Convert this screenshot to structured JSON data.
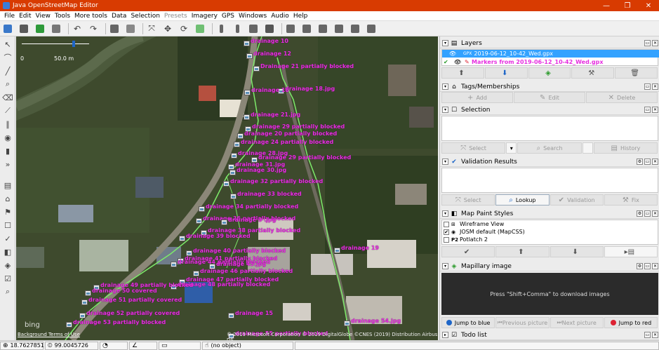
{
  "window": {
    "title": "Java OpenStreetMap Editor",
    "min": "—",
    "max": "❐",
    "close": "✕"
  },
  "menu": [
    {
      "label": "File",
      "enabled": true
    },
    {
      "label": "Edit",
      "enabled": true
    },
    {
      "label": "View",
      "enabled": true
    },
    {
      "label": "Tools",
      "enabled": true
    },
    {
      "label": "More tools",
      "enabled": true
    },
    {
      "label": "Data",
      "enabled": true
    },
    {
      "label": "Selection",
      "enabled": true
    },
    {
      "label": "Presets",
      "enabled": false
    },
    {
      "label": "Imagery",
      "enabled": true
    },
    {
      "label": "GPS",
      "enabled": true
    },
    {
      "label": "Windows",
      "enabled": true
    },
    {
      "label": "Audio",
      "enabled": true
    },
    {
      "label": "Help",
      "enabled": true
    }
  ],
  "map": {
    "scale_zero": "0",
    "scale_max": "50.0 m",
    "bing": "bing",
    "terms": "Background Terms of Use",
    "copyright": "© 2019 Microsoft Corporation © 2019 DigitalGlobe ©CNES (2019) Distribution Airbus DS",
    "labels": [
      "drainage 10",
      "drainage 12",
      "Drainage 21 partially blocked",
      "drainage 18.jpg",
      "drainage 18",
      "drainage 21.jpg",
      "drainage 29 partially blocked",
      "drainage 20 partially blocked",
      "drainage 24 partially blocked",
      "drainage 28.jpg",
      "drainage 29 partially blocked",
      "drainage 31.jpg",
      "drainage 30.jpg",
      "drainage 32 partially blocked",
      "drainage 33 blocked",
      "drainage 34 partially blocked",
      "drainage 36 partially blocked",
      "drainage 3 .jpg",
      "drainage 38 partially blocked",
      "drainage 39 blocked",
      "drainage 40 partially blocked",
      "drainage 41 partially blocked",
      "drainage 44 partially blocked",
      "drainage 45.jpg",
      "drainage 46 partially blocked",
      "drainage 47 partially blocked",
      "drainage 48 partially blocked",
      "drainage 49 partially blocked",
      "drainage 50 covered",
      "drainage 51 partially covered",
      "drainage 52 partially covered",
      "drainage 53 partially blocked",
      "drainage 15",
      "drainage 54.jpg",
      "drainage 55 partially blocked",
      "drainage 19"
    ]
  },
  "panels": {
    "layers": {
      "title": "Layers",
      "items": [
        {
          "name": "2019-06-12_10-42_Wed.gpx",
          "selected": true,
          "tag": "GPX"
        },
        {
          "name": "Markers from 2019-06-12_10-42_Wed.gpx",
          "selected": false,
          "tag": "MK"
        }
      ]
    },
    "tags": {
      "title": "Tags/Memberships",
      "add": "Add",
      "edit": "Edit",
      "delete": "Delete"
    },
    "selection": {
      "title": "Selection",
      "select": "Select",
      "search": "Search",
      "history": "History"
    },
    "validation": {
      "title": "Validation Results",
      "select": "Select",
      "lookup": "Lookup",
      "validation": "Validation",
      "fix": "Fix"
    },
    "paint": {
      "title": "Map Paint Styles",
      "styles": [
        {
          "label": "Wireframe View",
          "checked": false,
          "icon": "W"
        },
        {
          "label": "JOSM default (MapCSS)",
          "checked": true,
          "icon": "J"
        },
        {
          "label": "Potlatch 2",
          "checked": false,
          "icon": "P2"
        }
      ]
    },
    "mapillary": {
      "title": "Mapillary image",
      "message": "Press \"Shift+Comma\" to download images",
      "buttons": [
        "Jump to blue",
        "Previous picture",
        "Next picture",
        "Jump to red"
      ]
    },
    "todo": {
      "title": "Todo list"
    }
  },
  "status": {
    "lat": "18.7627851",
    "lon": "99.0045726",
    "object": "(no object)"
  },
  "colors": {
    "title_bg": "#d83b01",
    "label": "#e62ee0",
    "track": "#7dea6a",
    "selected_layer": "#33a2ff"
  }
}
